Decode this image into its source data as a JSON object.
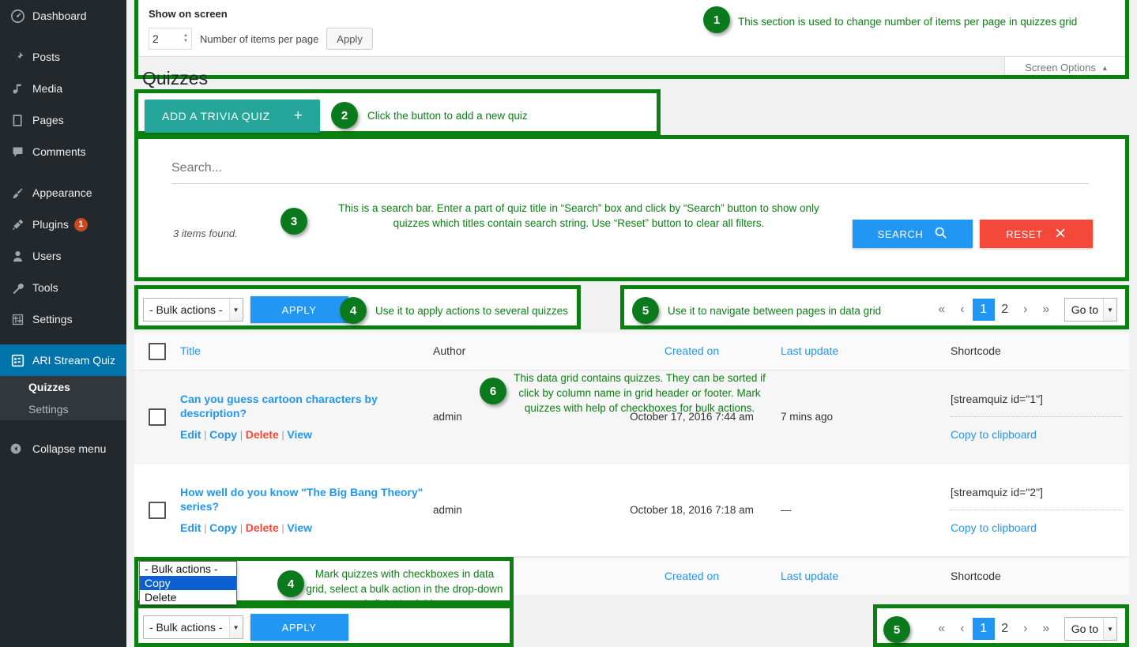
{
  "sidebar": {
    "items": [
      {
        "label": "Dashboard",
        "icon": "dashboard-icon"
      },
      {
        "label": "Posts",
        "icon": "pin-icon"
      },
      {
        "label": "Media",
        "icon": "media-icon"
      },
      {
        "label": "Pages",
        "icon": "pages-icon"
      },
      {
        "label": "Comments",
        "icon": "comments-icon"
      },
      {
        "label": "Appearance",
        "icon": "brush-icon"
      },
      {
        "label": "Plugins",
        "icon": "plug-icon",
        "badge": "1"
      },
      {
        "label": "Users",
        "icon": "user-icon"
      },
      {
        "label": "Tools",
        "icon": "wrench-icon"
      },
      {
        "label": "Settings",
        "icon": "sliders-icon"
      },
      {
        "label": "ARI Stream Quiz",
        "icon": "grid-icon",
        "active": true
      }
    ],
    "submenu": [
      {
        "label": "Quizzes",
        "current": true
      },
      {
        "label": "Settings",
        "current": false
      }
    ],
    "collapse_label": "Collapse menu"
  },
  "screen_options": {
    "title": "Show on screen",
    "items_per_page_value": "2",
    "items_per_page_label": "Number of items per page",
    "apply_label": "Apply",
    "tab_label": "Screen Options"
  },
  "page": {
    "title": "Quizzes"
  },
  "add_quiz": {
    "label": "ADD A TRIVIA QUIZ",
    "plus": "+"
  },
  "search": {
    "placeholder": "Search...",
    "value": "",
    "items_found": "3 items found.",
    "search_label": "SEARCH",
    "reset_label": "RESET"
  },
  "bulk": {
    "selected": "- Bulk actions -",
    "apply_label": "APPLY",
    "options": [
      "- Bulk actions -",
      "Copy",
      "Delete"
    ],
    "highlighted_option": "Copy"
  },
  "pagination": {
    "first": "«",
    "prev": "‹",
    "pages": [
      "1",
      "2"
    ],
    "current": "1",
    "next": "›",
    "last": "»",
    "goto_label": "Go to"
  },
  "table": {
    "columns": [
      {
        "label": "Title",
        "sortable": true
      },
      {
        "label": "Author",
        "sortable": false
      },
      {
        "label": "Created on",
        "sortable": true
      },
      {
        "label": "Last update",
        "sortable": true
      },
      {
        "label": "Shortcode",
        "sortable": false
      }
    ],
    "rows": [
      {
        "title": "Can you guess cartoon characters by description?",
        "actions": [
          "Edit",
          "Copy",
          "Delete",
          "View"
        ],
        "author": "admin",
        "created_on": "October 17, 2016 7:44 am",
        "last_update": "7 mins ago",
        "shortcode": "[streamquiz id=\"1\"]",
        "copy_label": "Copy to clipboard"
      },
      {
        "title": "How well do you know \"The Big Bang Theory\" series?",
        "actions": [
          "Edit",
          "Copy",
          "Delete",
          "View"
        ],
        "author": "admin",
        "created_on": "October 18, 2016 7:18 am",
        "last_update": "—",
        "shortcode": "[streamquiz id=\"2\"]",
        "copy_label": "Copy to clipboard"
      }
    ]
  },
  "annotations": [
    {
      "num": "1",
      "text": "This section is used to change number of items per page in quizzes grid"
    },
    {
      "num": "2",
      "text": "Click the button to add a new quiz"
    },
    {
      "num": "3",
      "text": "This is a search bar. Enter a part of quiz title in “Search” box and click by “Search” button to show only quizzes which titles contain search string. Use “Reset” button to clear all filters."
    },
    {
      "num": "4",
      "text": "Use it to apply actions to several quizzes"
    },
    {
      "num": "5",
      "text": "Use it to navigate between pages in data grid"
    },
    {
      "num": "6",
      "text": "This data grid contains quizzes. They can be sorted if click by column name in grid header or footer. Mark quizzes with help of checkboxes for bulk actions."
    },
    {
      "num": "4",
      "text": "Mark quizzes with checkboxes in data grid, select a bulk action in the drop-down and click “Apply” button"
    },
    {
      "num": "5",
      "text": ""
    }
  ],
  "colors": {
    "annotation_green": "#0a8010",
    "accent_blue": "#2196f3",
    "teal": "#26a69a",
    "red": "#f4483a",
    "sidebar_bg": "#23282d",
    "active_blue": "#0073aa"
  }
}
